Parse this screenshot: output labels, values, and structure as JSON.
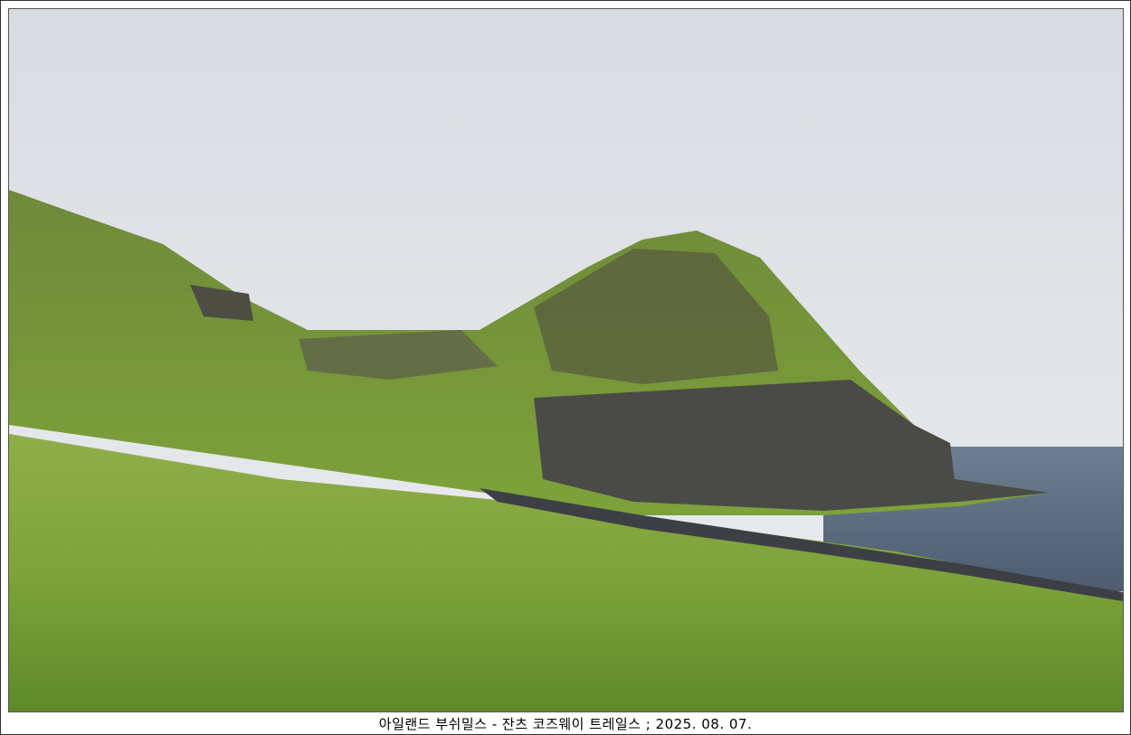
{
  "caption": "아일랜드 부쉬밀스 - 잔츠 코즈웨이 트레일스 ; 2025. 08. 07."
}
